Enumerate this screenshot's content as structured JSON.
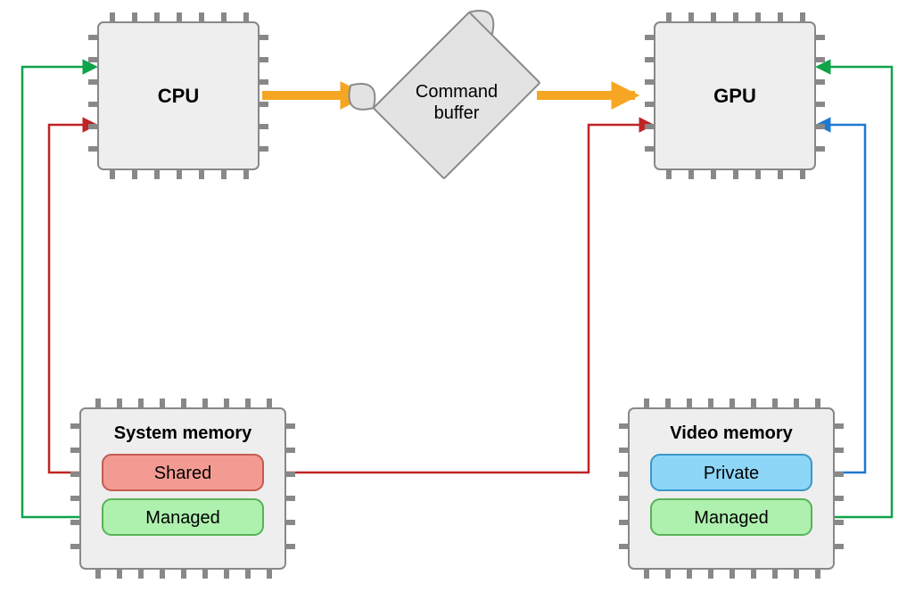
{
  "nodes": {
    "cpu": {
      "label": "CPU"
    },
    "gpu": {
      "label": "GPU"
    },
    "cmdbuf": {
      "line1": "Command",
      "line2": "buffer"
    },
    "sysmem": {
      "title": "System memory",
      "slot1": "Shared",
      "slot2": "Managed"
    },
    "vidmem": {
      "title": "Video memory",
      "slot1": "Private",
      "slot2": "Managed"
    }
  },
  "arrows": {
    "cpu_to_cmdbuf": {
      "from": "CPU",
      "to": "Command buffer",
      "color": "orange",
      "bidir": false
    },
    "cmdbuf_to_gpu": {
      "from": "Command buffer",
      "to": "GPU",
      "color": "orange",
      "bidir": false
    },
    "cpu_shared": {
      "from": "CPU",
      "to": "System memory / Shared",
      "color": "red",
      "bidir": true
    },
    "cpu_managed": {
      "from": "CPU",
      "to": "System memory / Managed",
      "color": "green",
      "bidir": true
    },
    "gpu_shared": {
      "from": "GPU",
      "to": "System memory / Shared",
      "color": "red",
      "bidir": true
    },
    "gpu_private": {
      "from": "GPU",
      "to": "Video memory / Private",
      "color": "blue",
      "bidir": true
    },
    "gpu_managed": {
      "from": "GPU",
      "to": "Video memory / Managed",
      "color": "green",
      "bidir": true
    }
  },
  "colors": {
    "orange": "#f6a623",
    "red": "#c02424",
    "green": "#0fa34a",
    "blue": "#1f78d1",
    "chip_bg": "#eeeeee",
    "chip_border": "#888888",
    "shared_bg": "#f39b93",
    "managed_bg": "#aef0ad",
    "private_bg": "#8dd6f7"
  }
}
